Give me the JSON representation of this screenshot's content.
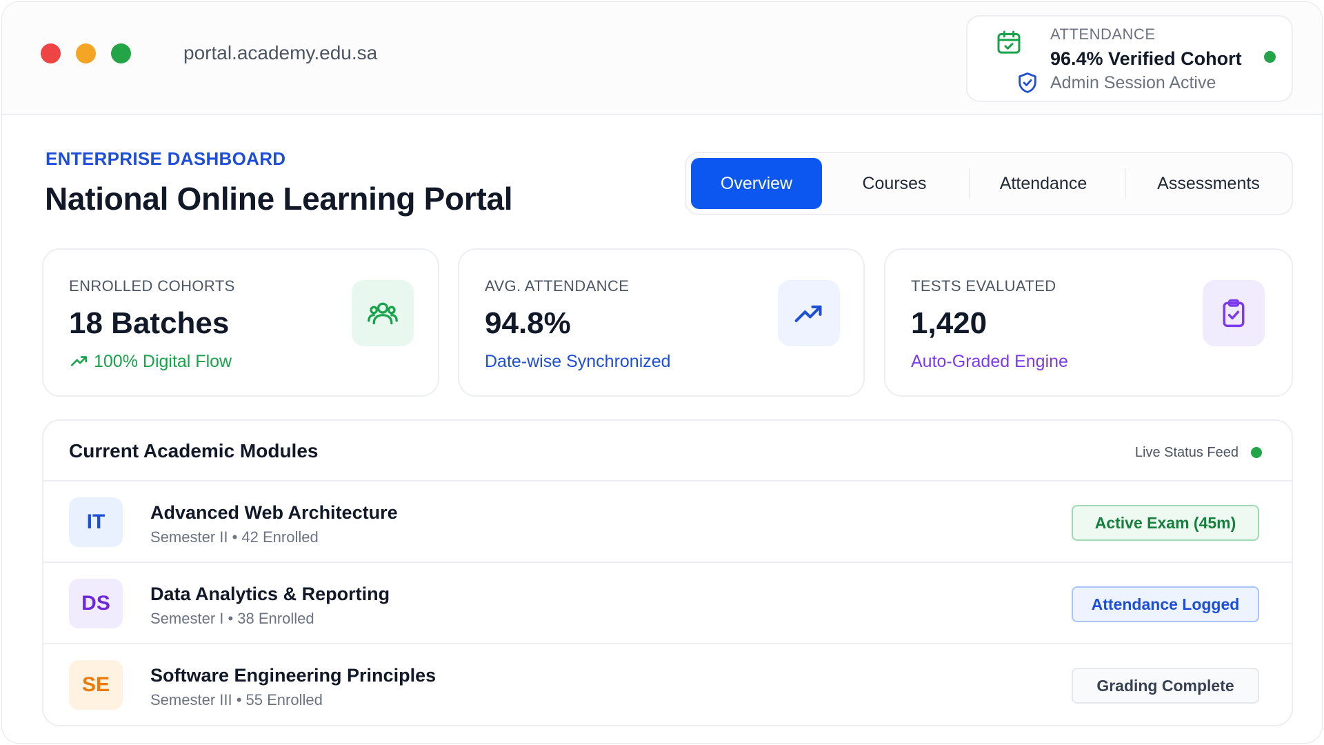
{
  "window": {
    "url": "portal.academy.edu.sa"
  },
  "attendance_card": {
    "label": "ATTENDANCE",
    "value": "96.4% Verified Cohort",
    "session": "Admin Session Active",
    "calendar_icon": "calendar-check-icon",
    "shield_icon": "shield-check-icon",
    "status_color": "#22a447"
  },
  "header": {
    "eyebrow": "ENTERPRISE DASHBOARD",
    "title": "National Online Learning Portal"
  },
  "tabs": [
    {
      "label": "Overview",
      "active": true
    },
    {
      "label": "Courses",
      "active": false
    },
    {
      "label": "Attendance",
      "active": false
    },
    {
      "label": "Assessments",
      "active": false
    }
  ],
  "stats": [
    {
      "label": "ENROLLED COHORTS",
      "value": "18 Batches",
      "sub": "100% Digital Flow",
      "icon": "users-icon",
      "accent": "#16a34a"
    },
    {
      "label": "AVG. ATTENDANCE",
      "value": "94.8%",
      "sub": "Date-wise Synchronized",
      "icon": "trending-up-icon",
      "accent": "#1d4ed8"
    },
    {
      "label": "TESTS EVALUATED",
      "value": "1,420",
      "sub": "Auto-Graded Engine",
      "icon": "clipboard-check-icon",
      "accent": "#7c3aed"
    }
  ],
  "modules": {
    "title": "Current Academic Modules",
    "live_label": "Live Status Feed",
    "rows": [
      {
        "code": "IT",
        "title": "Advanced Web Architecture",
        "sub": "Semester II • 42 Enrolled",
        "status": "Active Exam (45m)"
      },
      {
        "code": "DS",
        "title": "Data Analytics & Reporting",
        "sub": "Semester I • 38 Enrolled",
        "status": "Attendance Logged"
      },
      {
        "code": "SE",
        "title": "Software Engineering Principles",
        "sub": "Semester III • 55 Enrolled",
        "status": "Grading Complete"
      }
    ]
  },
  "colors": {
    "primary": "#0b57f0",
    "success": "#16a34a",
    "purple": "#7c3aed",
    "orange": "#ea7a0c"
  }
}
